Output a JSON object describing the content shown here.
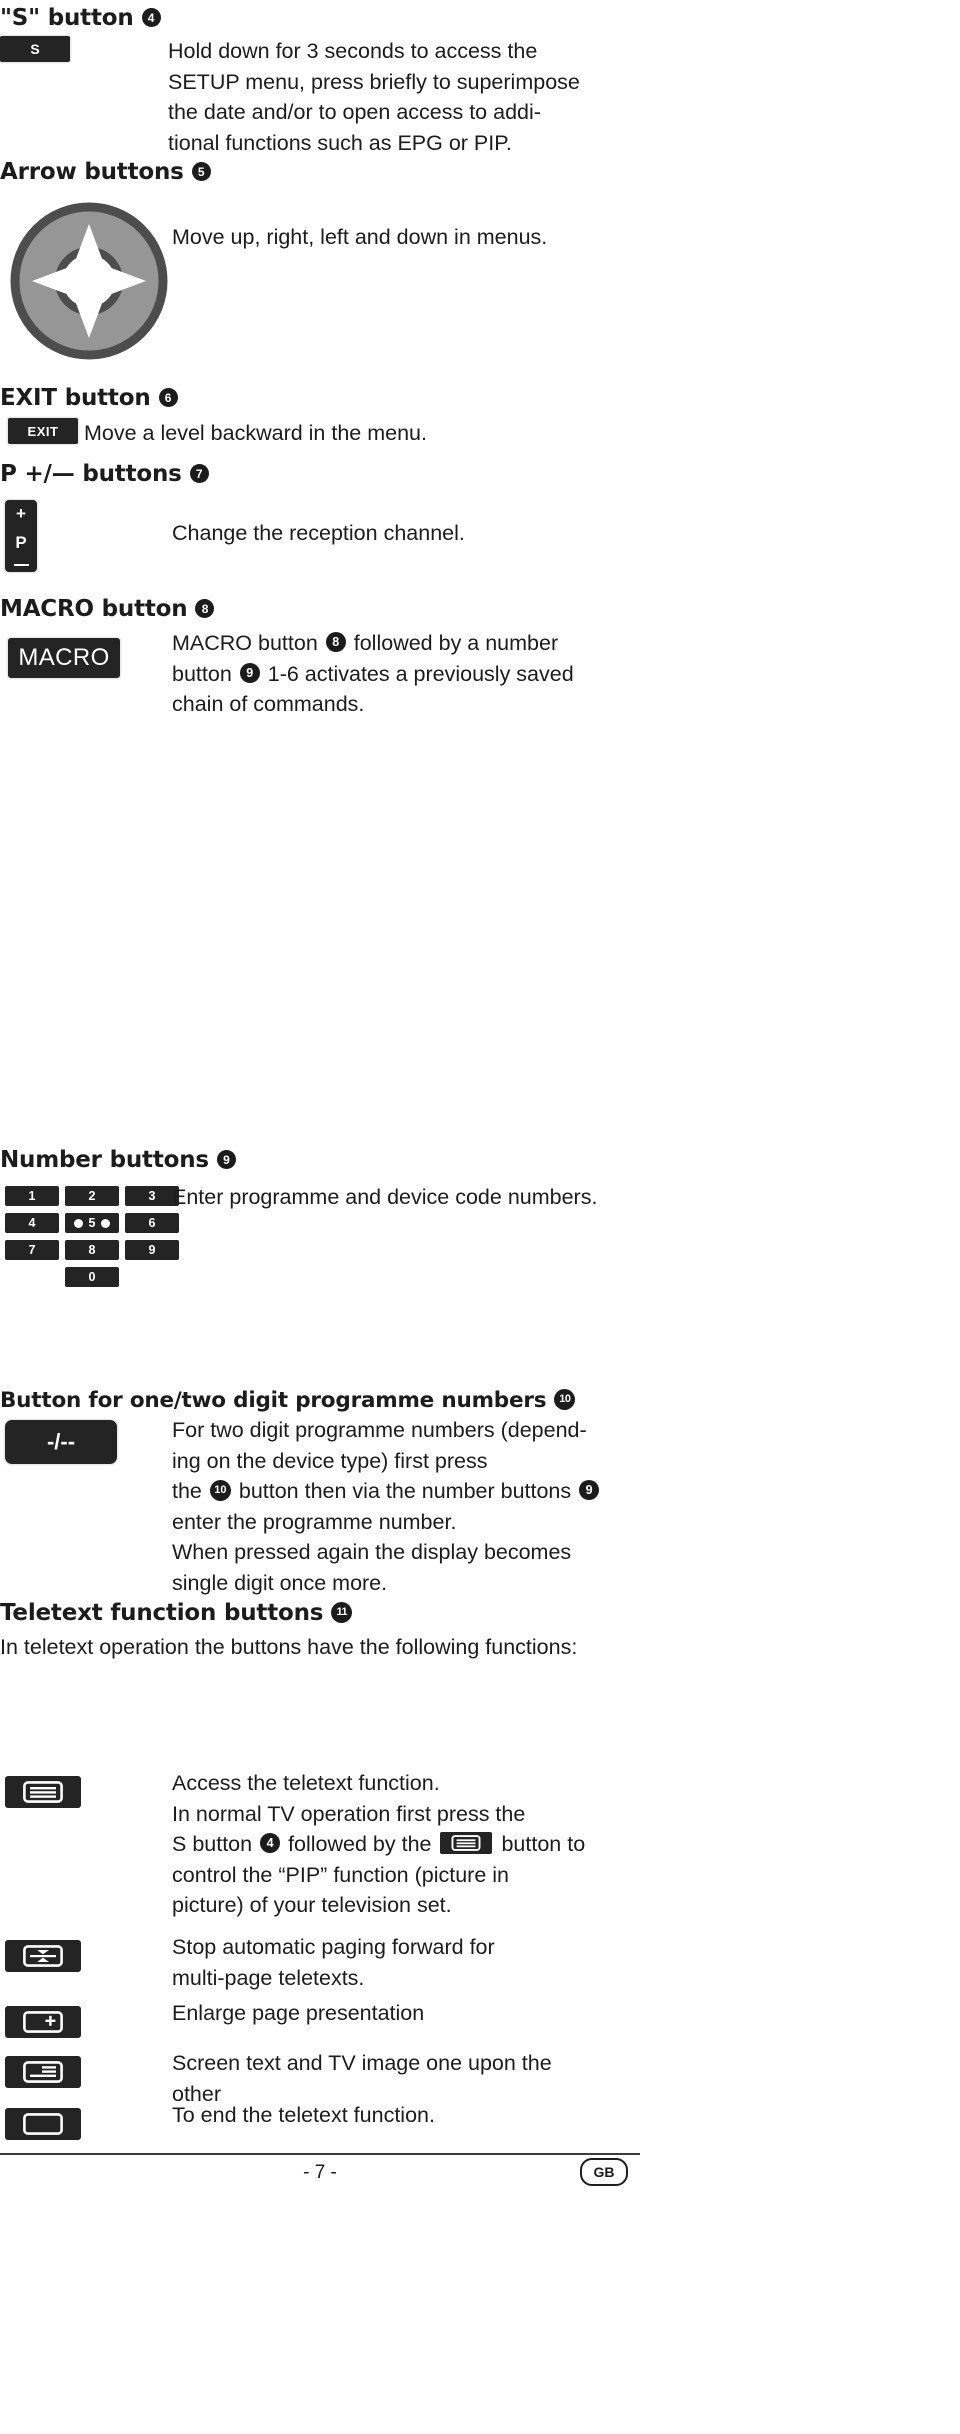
{
  "page": {
    "number_label": "- 7 -",
    "locale_badge": "GB"
  },
  "sections": [
    {
      "id": "s-button",
      "title": "\"S\" button",
      "marker": "4",
      "key_label": "S",
      "description": "Hold down for 3 seconds to access the SETUP menu, press briefly to superimpose the date and/or to open access to additional functions such as EPG or PIP.",
      "lines": [
        "Hold down for 3 seconds to access the",
        "SETUP menu, press briefly to superimpose",
        "the date and/or to open access to addi-",
        "tional functions such as EPG or PIP."
      ]
    },
    {
      "id": "arrow-buttons",
      "title": "Arrow buttons",
      "marker": "5",
      "description": "Move up, right, left and down in menus.",
      "icon": "arrow-wheel-icon"
    },
    {
      "id": "exit-button",
      "title": "EXIT button",
      "marker": "6",
      "key_label": "EXIT",
      "description": "Move a level backward in the menu."
    },
    {
      "id": "p-buttons",
      "title": "P +/— buttons",
      "marker": "7",
      "key_parts": {
        "plus": "+",
        "letter": "P",
        "minus": "—"
      },
      "description": "Change the reception channel."
    },
    {
      "id": "macro-button",
      "title": "MACRO button",
      "marker": "8",
      "key_label": "MACRO",
      "lines": [
        "MACRO button ➁ followed by a number",
        "button ➂ 1-6 activates a previously saved",
        "chain of commands."
      ],
      "desc_parts": {
        "a": "MACRO button",
        "marker1": "8",
        "b": "followed by a number",
        "c": "button",
        "marker2": "9",
        "d": "1-6 activates a previously saved",
        "e": "chain of commands."
      }
    },
    {
      "id": "number-buttons",
      "title": "Number buttons",
      "marker": "9",
      "description": "Enter programme and device code numbers.",
      "keys": [
        "1",
        "2",
        "3",
        "4",
        "5",
        "6",
        "7",
        "8",
        "9",
        "0"
      ],
      "five_has_dots": true
    },
    {
      "id": "one-two-digit-button",
      "title": "Button for one/two digit programme numbers",
      "marker": "10",
      "key_label": "-/--",
      "desc_parts": {
        "l1": "For two digit programme numbers (depend-",
        "l2": "ing on the device type) first press",
        "l3a": "the",
        "l3marker": "10",
        "l3b": "button then via the number buttons",
        "l3marker2": "9",
        "l4": "enter the programme number.",
        "l5": "When pressed again the display becomes",
        "l6": "single digit once more."
      }
    },
    {
      "id": "teletext-function-buttons",
      "title": "Teletext function buttons",
      "marker": "11",
      "intro": "In teletext operation the buttons have the following functions:",
      "rows": [
        {
          "icon": "teletext-lines-icon",
          "desc_parts": {
            "l1": "Access the teletext function.",
            "l2": "In normal TV operation first press the",
            "l3a": "S button",
            "l3marker": "4",
            "l3b": "followed by the",
            "l3icon": "teletext-lines-icon",
            "l3c": "button to",
            "l4": "control the “PIP” function (picture in",
            "l5": "picture) of your television set."
          }
        },
        {
          "icon": "teletext-hold-icon",
          "lines": [
            "Stop automatic paging forward for",
            "multi-page teletexts."
          ]
        },
        {
          "icon": "teletext-enlarge-icon",
          "lines": [
            "Enlarge page presentation"
          ]
        },
        {
          "icon": "teletext-mix-icon",
          "lines": [
            "Screen text and TV image one upon the",
            "other"
          ]
        },
        {
          "icon": "teletext-off-icon",
          "lines": [
            "To end the teletext function."
          ]
        }
      ]
    }
  ],
  "colors": {
    "ink": "#1c1c1c",
    "key_fill": "#242424",
    "key_text": "#ffffff",
    "wheel_ring": "#4d4d4d",
    "wheel_face": "#969696",
    "page_bg": "#ffffff"
  }
}
